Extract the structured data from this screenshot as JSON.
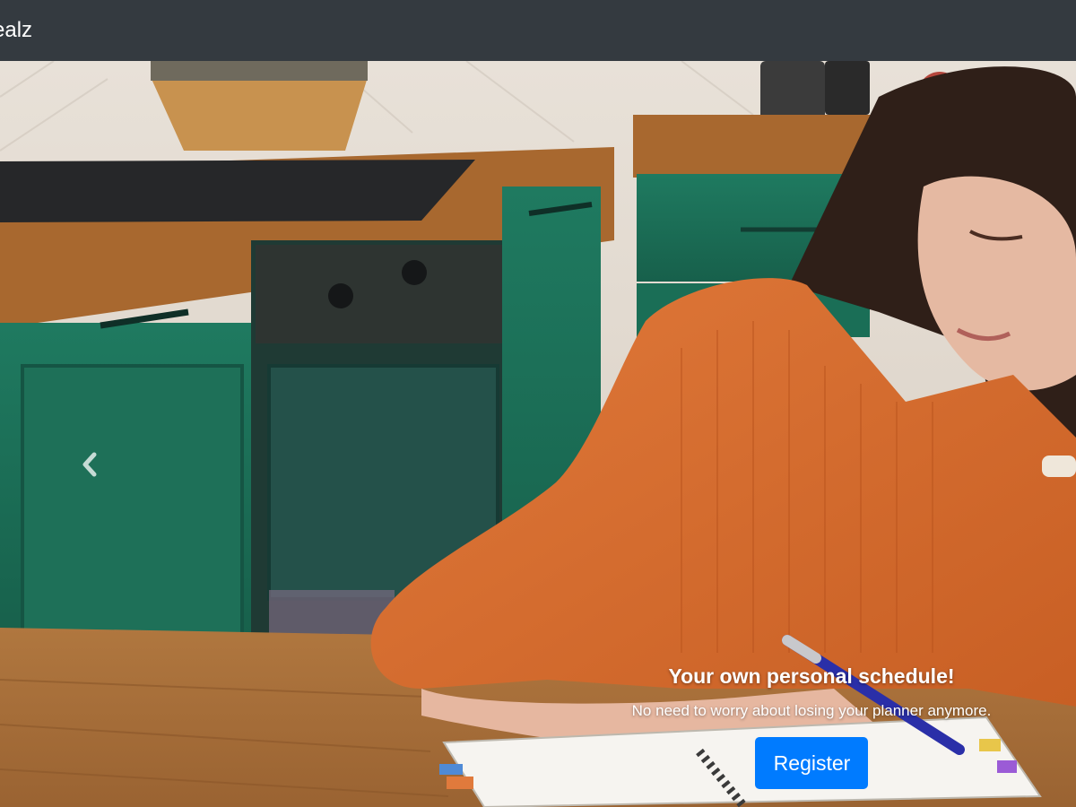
{
  "navbar": {
    "brand": "ealz"
  },
  "carousel": {
    "prev_icon": "chevron-left-icon",
    "slide": {
      "image_subject": "woman-writing-in-planner-at-kitchen-table",
      "caption_title": "Your own personal schedule!",
      "caption_text": "No need to worry about losing your planner anymore.",
      "button_label": "Register"
    }
  },
  "colors": {
    "navbar_bg": "#343a40",
    "primary_button": "#007bff",
    "text_light": "#ffffff"
  }
}
